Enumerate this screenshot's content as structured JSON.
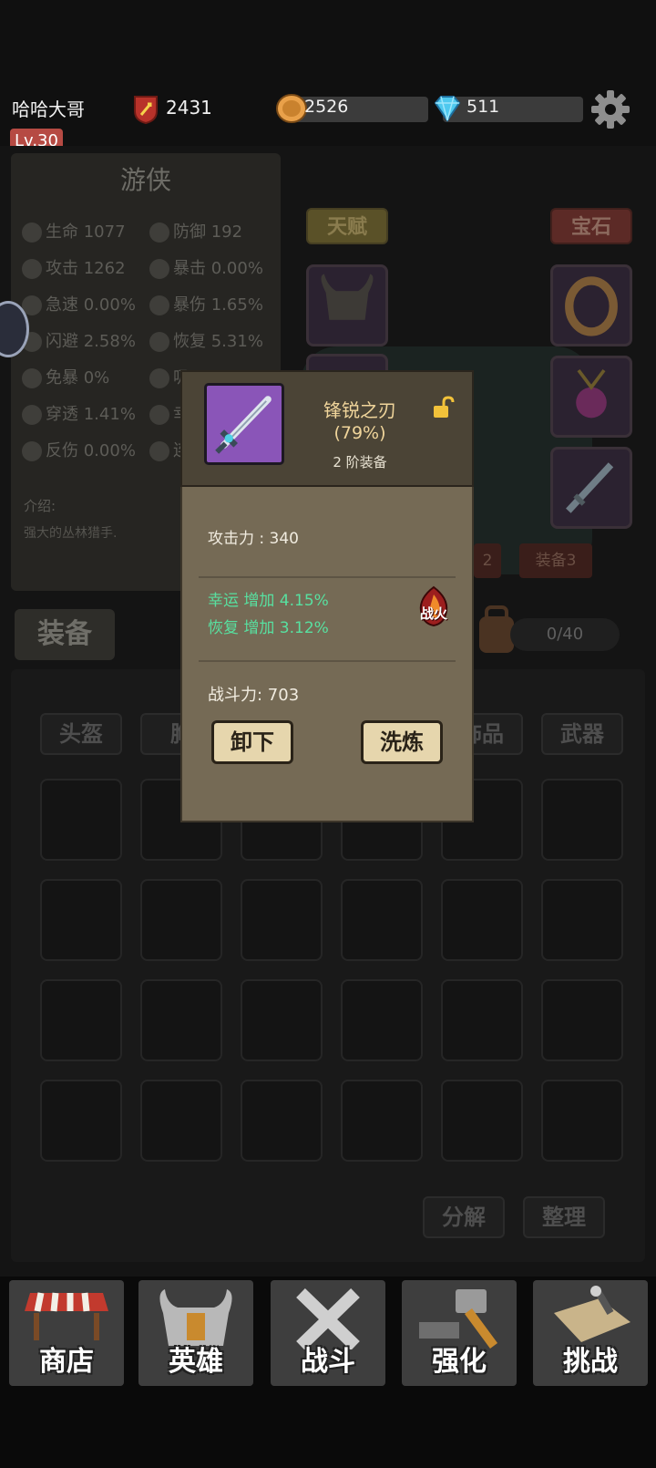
{
  "player": {
    "name": "哈哈大哥",
    "level": "Lv.30",
    "power": "2431"
  },
  "resources": {
    "coins": "2526",
    "gems": "511"
  },
  "hero": {
    "class": "游侠",
    "stats": [
      {
        "label": "生命",
        "value": "1077"
      },
      {
        "label": "防御",
        "value": "192"
      },
      {
        "label": "攻击",
        "value": "1262"
      },
      {
        "label": "暴击",
        "value": "0.00%"
      },
      {
        "label": "急速",
        "value": "0.00%"
      },
      {
        "label": "暴伤",
        "value": "1.65%"
      },
      {
        "label": "闪避",
        "value": "2.58%"
      },
      {
        "label": "恢复",
        "value": "5.31%"
      },
      {
        "label": "免暴",
        "value": "0%"
      },
      {
        "label": "吸",
        "value": ""
      },
      {
        "label": "穿透",
        "value": "1.41%"
      },
      {
        "label": "幸",
        "value": ""
      },
      {
        "label": "反伤",
        "value": "0.00%"
      },
      {
        "label": "连",
        "value": ""
      }
    ],
    "intro_label": "介绍:",
    "intro_text": "强大的丛林猎手."
  },
  "side": {
    "talent": "天赋",
    "gem": "宝石",
    "equip_tab2": "2",
    "equip_tab3": "装备3"
  },
  "equipment": {
    "header": "装备",
    "bag_count": "0/40",
    "categories": [
      "头盔",
      "胸",
      "",
      "",
      "饰品",
      "武器"
    ],
    "actions": {
      "decompose": "分解",
      "sort": "整理"
    }
  },
  "popup": {
    "item_name": "锋锐之刃",
    "item_pct": "(79%)",
    "item_tier": "2 阶装备",
    "attack": "攻击力 : 340",
    "bonus1": "幸运 增加 4.15%",
    "bonus2": "恢复 增加 3.12%",
    "badge": "战火",
    "combat_power": "战斗力: 703",
    "unequip": "卸下",
    "reforge": "洗炼"
  },
  "nav": [
    {
      "label": "商店",
      "icon": "shop-icon"
    },
    {
      "label": "英雄",
      "icon": "helmet-icon"
    },
    {
      "label": "战斗",
      "icon": "crossed-swords-icon"
    },
    {
      "label": "强化",
      "icon": "hammer-icon"
    },
    {
      "label": "挑战",
      "icon": "map-icon"
    }
  ],
  "colors": {
    "item_bg": "#8a55b8",
    "bonus_text": "#58e0a0",
    "item_name": "#f0d59b",
    "popup_body": "#756a55"
  }
}
